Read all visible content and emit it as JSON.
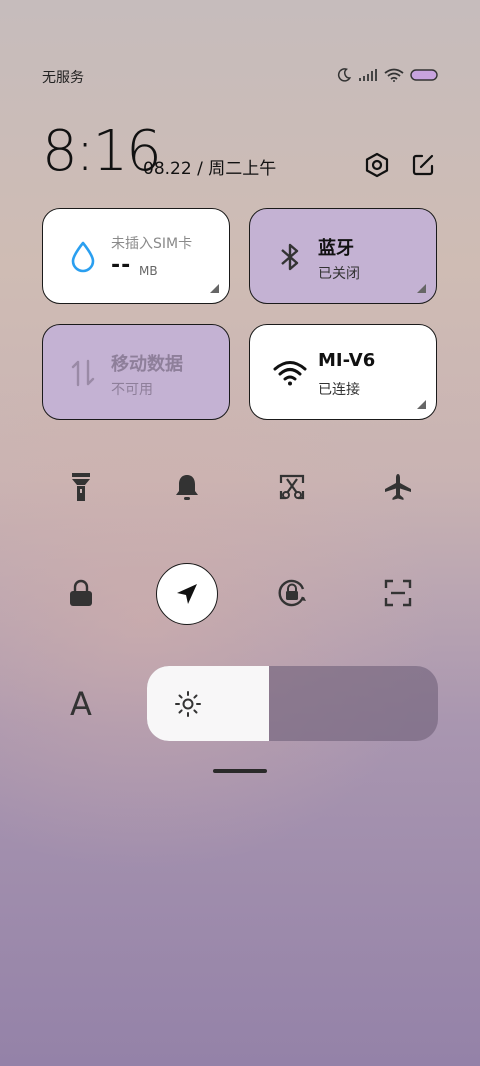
{
  "status_bar": {
    "carrier": "无服务",
    "icons": [
      "moon-icon",
      "signal-icon",
      "wifi-icon",
      "battery-icon"
    ]
  },
  "header": {
    "time": "8:16",
    "date": "08.22 / 周二上午",
    "icons": [
      "settings-icon",
      "edit-icon"
    ]
  },
  "tiles": {
    "data_usage": {
      "label": "未插入SIM卡",
      "value": "--",
      "unit": "MB",
      "icon": "water-drop-icon",
      "accent": "#2a9ff0"
    },
    "bluetooth": {
      "title": "蓝牙",
      "status": "已关闭",
      "icon": "bluetooth-icon"
    },
    "mobile_data": {
      "title": "移动数据",
      "status": "不可用",
      "icon": "data-arrows-icon"
    },
    "wifi": {
      "title": "MI-V6",
      "status": "已连接",
      "icon": "wifi-icon"
    }
  },
  "quick_toggles": [
    "flashlight-icon",
    "bell-icon",
    "screenshot-icon",
    "airplane-icon",
    "lock-icon",
    "location-icon",
    "rotation-lock-icon",
    "scan-icon"
  ],
  "font_size_glyph": "A",
  "brightness": {
    "level": 0.42,
    "icon": "sun-icon"
  },
  "colors": {
    "tile_purple": "#c4b2d3",
    "tile_white": "#ffffff",
    "accent_blue": "#2a9ff0"
  }
}
